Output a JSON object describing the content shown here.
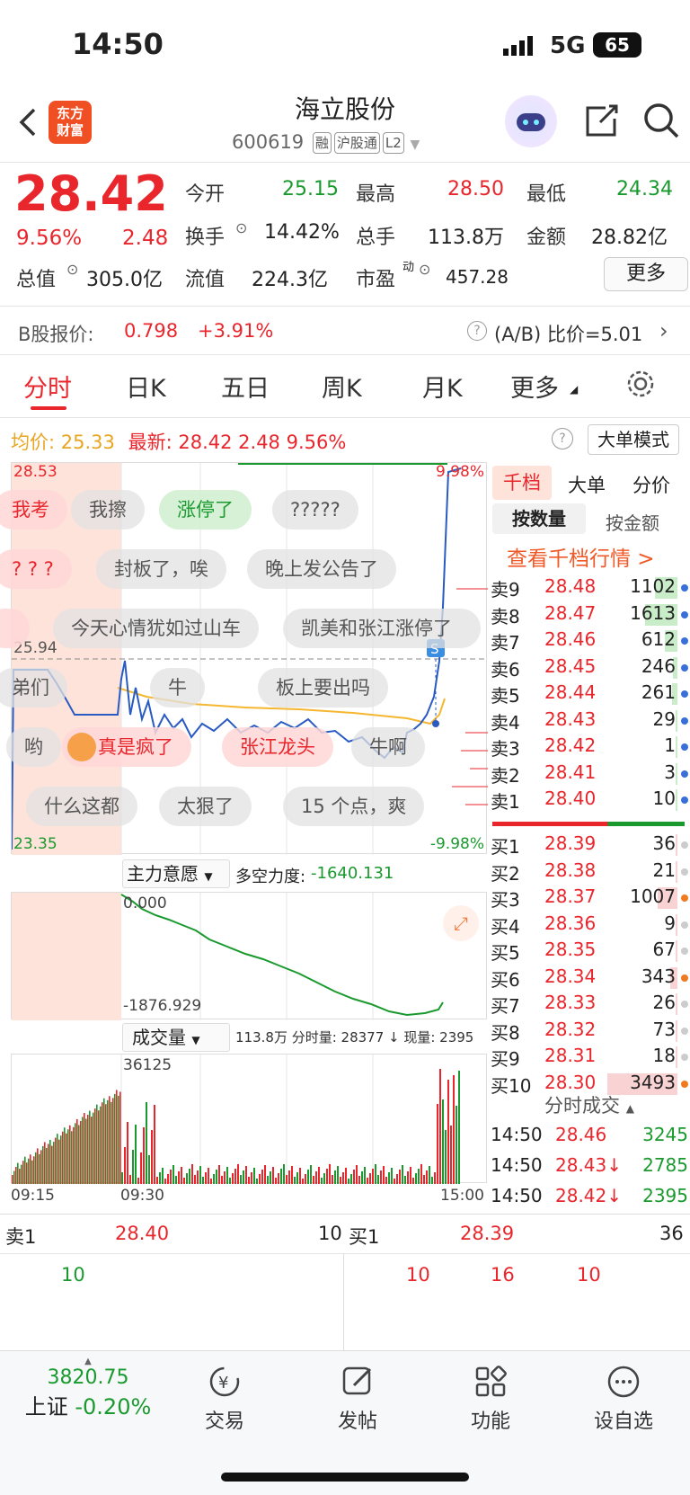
{
  "status": {
    "time": "14:50",
    "network": "5G",
    "battery": "65"
  },
  "header": {
    "app_logo": "东方财富",
    "title": "海立股份",
    "code": "600619",
    "tags": [
      "融",
      "沪股通",
      "L2"
    ]
  },
  "quote": {
    "price": "28.42",
    "change_pct": "9.56%",
    "change": "2.48",
    "open_label": "今开",
    "open": "25.15",
    "high_label": "最高",
    "high": "28.50",
    "low_label": "最低",
    "low": "24.34",
    "turnover_label": "换手",
    "turnover": "14.42%",
    "volume_label": "总手",
    "volume": "113.8万",
    "amount_label": "金额",
    "amount": "28.82亿",
    "mcap_label": "总值",
    "mcap": "305.0亿",
    "float_label": "流值",
    "float": "224.3亿",
    "pe_label": "市盈",
    "pe_sup": "动",
    "pe": "457.28",
    "more": "更多"
  },
  "bshare": {
    "label": "B股报价:",
    "price": "0.798",
    "pct": "+3.91%",
    "ratio": "(A/B) 比价=5.01"
  },
  "tabs": [
    "分时",
    "日K",
    "五日",
    "周K",
    "月K",
    "更多"
  ],
  "info": {
    "avg_label": "均价:",
    "avg": "25.33",
    "last_label": "最新:",
    "last": "28.42",
    "chg": "2.48",
    "pct": "9.56%",
    "mode": "大单模式"
  },
  "chart": {
    "top_price": "28.53",
    "top_pct": "9.98%",
    "bottom_price": "23.35",
    "bottom_pct": "-9.98%",
    "ref_price": "25.94"
  },
  "bubbles": [
    "我考",
    "我擦",
    "涨停了",
    "?????",
    "? ? ?",
    "封板了，唉",
    "晚上发公告了",
    "今天心情犹如过山车",
    "凯美和张江涨停了",
    "弟们",
    "牛",
    "板上要出吗",
    "哟",
    "真是疯了",
    "张江龙头",
    "牛啊",
    "什么这都",
    "太狠了",
    "15 个点，爽"
  ],
  "indicator": {
    "name": "主力意愿",
    "label": "多空力度:",
    "value": "-1640.131",
    "top": "0.000",
    "bottom": "-1876.929"
  },
  "volume": {
    "name": "成交量",
    "summary": "113.8万 分时量: 28377 ↓ 现量: 2395",
    "max": "36125",
    "times": [
      "09:15",
      "09:30",
      "15:00"
    ]
  },
  "side_tabs": [
    "千档",
    "大单",
    "分价"
  ],
  "sub_tabs": [
    "按数量",
    "按金额"
  ],
  "view_link": "查看千档行情 >",
  "asks": [
    [
      "卖9",
      "28.48",
      "1102"
    ],
    [
      "卖8",
      "28.47",
      "1613"
    ],
    [
      "卖7",
      "28.46",
      "612"
    ],
    [
      "卖6",
      "28.45",
      "246"
    ],
    [
      "卖5",
      "28.44",
      "261"
    ],
    [
      "卖4",
      "28.43",
      "29"
    ],
    [
      "卖3",
      "28.42",
      "1"
    ],
    [
      "卖2",
      "28.41",
      "3"
    ],
    [
      "卖1",
      "28.40",
      "10"
    ]
  ],
  "bids": [
    [
      "买1",
      "28.39",
      "36"
    ],
    [
      "买2",
      "28.38",
      "21"
    ],
    [
      "买3",
      "28.37",
      "1007"
    ],
    [
      "买4",
      "28.36",
      "9"
    ],
    [
      "买5",
      "28.35",
      "67"
    ],
    [
      "买6",
      "28.34",
      "343"
    ],
    [
      "买7",
      "28.33",
      "26"
    ],
    [
      "买8",
      "28.32",
      "73"
    ],
    [
      "买9",
      "28.31",
      "18"
    ],
    [
      "买10",
      "28.30",
      "3493"
    ]
  ],
  "ticks_title": "分时成交",
  "ticks": [
    [
      "14:50",
      "28.46",
      "3245"
    ],
    [
      "14:50",
      "28.43↓",
      "2785"
    ],
    [
      "14:50",
      "28.42↓",
      "2395"
    ]
  ],
  "queue": {
    "sell_label": "卖1",
    "sell_price": "28.40",
    "sell_qty": "10",
    "sell_items": [
      "10"
    ],
    "buy_label": "买1",
    "buy_price": "28.39",
    "buy_qty": "36",
    "buy_items": [
      "10",
      "16",
      "10"
    ]
  },
  "bottom": {
    "index_value": "3820.75",
    "index_name": "上证",
    "index_pct": "-0.20%",
    "items": [
      "交易",
      "发帖",
      "功能",
      "设自选"
    ]
  }
}
